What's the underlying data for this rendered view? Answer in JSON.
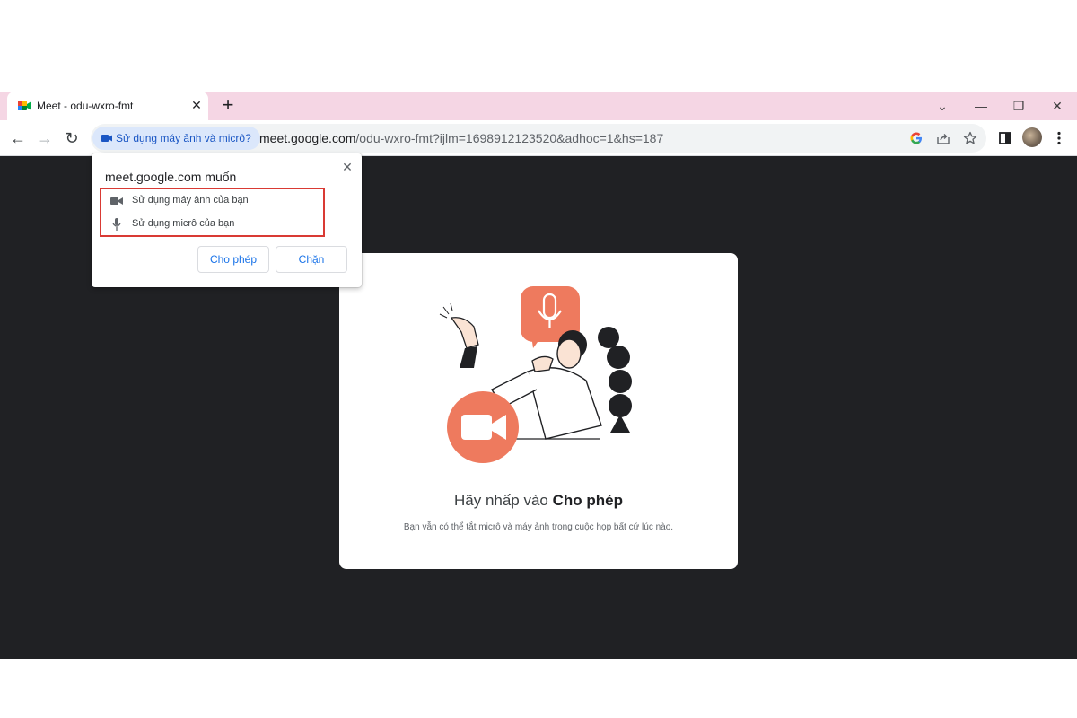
{
  "tab": {
    "title": "Meet - odu-wxro-fmt",
    "close": "✕",
    "new_tab": "+"
  },
  "window_controls": {
    "dropdown": "⌄",
    "minimize": "—",
    "restore": "❐",
    "close": "✕"
  },
  "nav": {
    "back": "←",
    "forward": "→",
    "reload": "↻"
  },
  "omnibox": {
    "chip_label": "Sử dụng máy ảnh và micrô?",
    "url_host": "meet.google.com",
    "url_rest": "/odu-wxro-fmt?ijlm=1698912123520&adhoc=1&hs=187"
  },
  "popup": {
    "title": "meet.google.com muốn",
    "close": "✕",
    "permissions": [
      {
        "icon": "camera-icon",
        "label": "Sử dụng máy ảnh của bạn"
      },
      {
        "icon": "microphone-icon",
        "label": "Sử dụng micrô của bạn"
      }
    ],
    "allow_label": "Cho phép",
    "block_label": "Chặn"
  },
  "card": {
    "title_prefix": "Hãy nhấp vào ",
    "title_bold": "Cho phép",
    "subtitle": "Bạn vẫn có thể tắt micrô và máy ảnh trong cuộc họp bất cứ lúc nào."
  },
  "colors": {
    "tabstrip": "#f5d6e4",
    "content_bg": "#202124",
    "accent_orange": "#ee7a5e",
    "highlight_red": "#d93a34",
    "chip_bg": "#dbe7fb",
    "link_blue": "#1a73e8"
  }
}
